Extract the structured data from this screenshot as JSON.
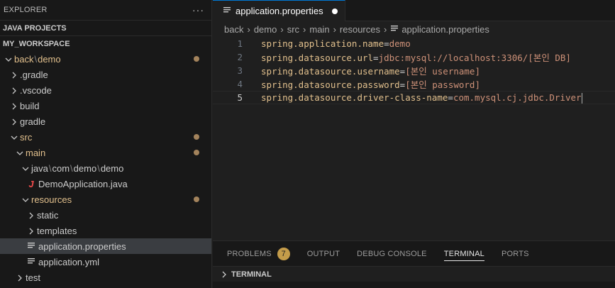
{
  "sidebar": {
    "header_title": "EXPLORER",
    "header_more": "···",
    "sections": [
      "JAVA PROJECTS",
      "MY_WORKSPACE"
    ],
    "tree": [
      {
        "label_parts": [
          "back",
          "demo"
        ],
        "indent": 0,
        "kind": "folder-open",
        "modified": true
      },
      {
        "label": ".gradle",
        "indent": 1,
        "kind": "folder-closed",
        "modified": false
      },
      {
        "label": ".vscode",
        "indent": 1,
        "kind": "folder-closed",
        "modified": false
      },
      {
        "label": "build",
        "indent": 1,
        "kind": "folder-closed",
        "modified": false
      },
      {
        "label": "gradle",
        "indent": 1,
        "kind": "folder-closed",
        "modified": false
      },
      {
        "label": "src",
        "indent": 1,
        "kind": "folder-open",
        "modified": true
      },
      {
        "label": "main",
        "indent": 2,
        "kind": "folder-open",
        "modified": true
      },
      {
        "label_parts": [
          "java",
          "com",
          "demo",
          "demo"
        ],
        "indent": 3,
        "kind": "folder-open",
        "modified": false
      },
      {
        "label": "DemoApplication.java",
        "indent": 4,
        "kind": "java-file",
        "modified": false
      },
      {
        "label": "resources",
        "indent": 3,
        "kind": "folder-open",
        "modified": true
      },
      {
        "label": "static",
        "indent": 4,
        "kind": "folder-closed",
        "modified": false
      },
      {
        "label": "templates",
        "indent": 4,
        "kind": "folder-closed",
        "modified": false
      },
      {
        "label": "application.properties",
        "indent": 4,
        "kind": "properties-file",
        "modified": false,
        "selected": true
      },
      {
        "label": "application.yml",
        "indent": 4,
        "kind": "properties-file",
        "modified": false
      },
      {
        "label": "test",
        "indent": 2,
        "kind": "folder-closed",
        "modified": false
      }
    ]
  },
  "editor": {
    "tab_label": "application.properties",
    "breadcrumb": [
      "back",
      "demo",
      "src",
      "main",
      "resources",
      "application.properties"
    ],
    "lines": [
      {
        "num": "1",
        "key": "spring.application.name",
        "value": "demo"
      },
      {
        "num": "2",
        "key": "spring.datasource.url",
        "value": "jdbc:mysql://localhost:3306/[본인 DB]"
      },
      {
        "num": "3",
        "key": "spring.datasource.username",
        "value": "[본인 username]"
      },
      {
        "num": "4",
        "key": "spring.datasource.password",
        "value": "[본인 password]"
      },
      {
        "num": "5",
        "key": "spring.datasource.driver-class-name",
        "value": "com.mysql.cj.jdbc.Driver"
      }
    ],
    "current_line": 5
  },
  "panel": {
    "tabs": [
      {
        "label": "PROBLEMS",
        "badge": "7"
      },
      {
        "label": "OUTPUT"
      },
      {
        "label": "DEBUG CONSOLE"
      },
      {
        "label": "TERMINAL",
        "active": true
      },
      {
        "label": "PORTS"
      }
    ],
    "terminal_header": "TERMINAL"
  },
  "colors": {
    "accent": "#0078d4",
    "modified": "#e2c08d",
    "string": "#ce9178",
    "java_icon": "#f14c4c"
  }
}
